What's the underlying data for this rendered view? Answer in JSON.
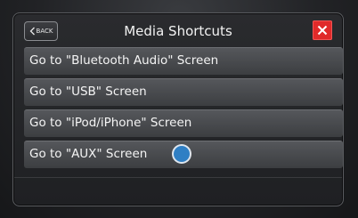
{
  "header": {
    "back_label": "BACK",
    "title": "Media Shortcuts",
    "close_icon": "close-icon"
  },
  "shortcuts": [
    {
      "label": "Go to \"Bluetooth Audio\" Screen"
    },
    {
      "label": "Go to \"USB\" Screen"
    },
    {
      "label": "Go to \"iPod/iPhone\" Screen"
    },
    {
      "label": "Go to \"AUX\" Screen",
      "touched": true
    }
  ],
  "colors": {
    "close_button": "#e02a2a",
    "touch_indicator": "#2f7fc4",
    "row_background": "#4a4c50"
  }
}
